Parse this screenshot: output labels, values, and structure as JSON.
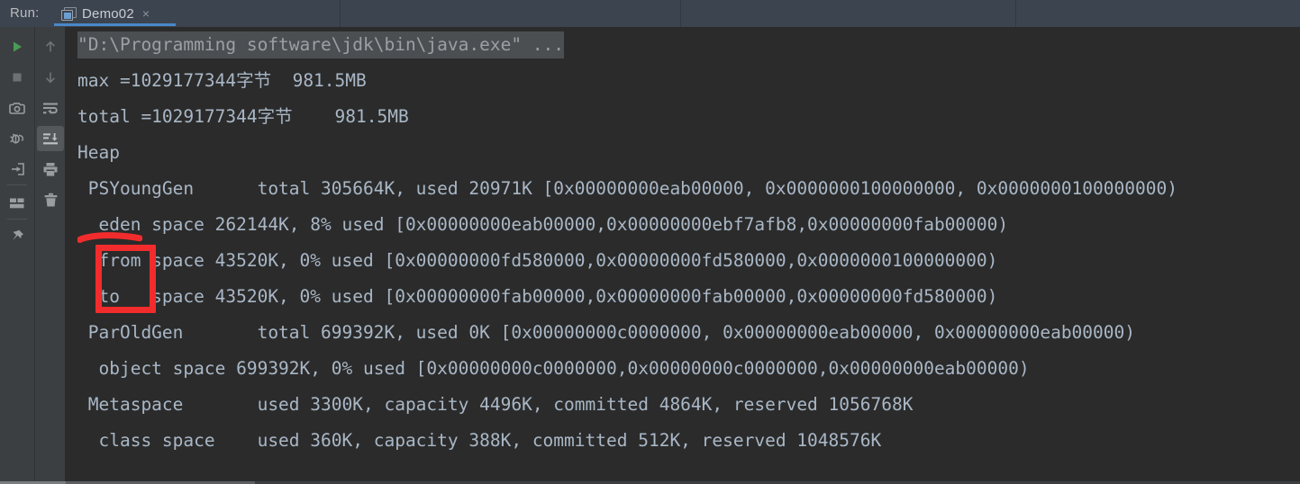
{
  "window": {
    "tool_window_title": "Run:",
    "background_color": "#2b2b2b",
    "tabbar_color": "#3c4450",
    "accent_color": "#4a88c7",
    "annotation_color": "#f22c2c"
  },
  "tabs": [
    {
      "label": "Demo02",
      "icon": "run-configuration-icon",
      "close_label": "×",
      "active": true
    }
  ],
  "toolbar_left": [
    {
      "name": "rerun-button",
      "icon": "play-triangle-icon",
      "enabled": true,
      "selected": false
    },
    {
      "name": "stop-button",
      "icon": "stop-square-icon",
      "enabled": false,
      "selected": false
    },
    {
      "name": "screenshot-button",
      "icon": "camera-icon",
      "enabled": true,
      "selected": false
    },
    {
      "name": "rerun-failed-button",
      "icon": "bug-rerun-icon",
      "enabled": true,
      "selected": false
    },
    {
      "name": "import-button",
      "icon": "arrow-into-box-icon",
      "enabled": true,
      "selected": false
    },
    {
      "name": "layout-button",
      "icon": "layout-panels-icon",
      "enabled": true,
      "selected": false
    },
    {
      "name": "pin-tab-button",
      "icon": "pin-icon",
      "enabled": true,
      "selected": false
    }
  ],
  "toolbar_right": [
    {
      "name": "up-the-stack-trace-button",
      "icon": "arrow-up-icon",
      "enabled": false,
      "selected": false
    },
    {
      "name": "down-the-stack-trace-button",
      "icon": "arrow-down-icon",
      "enabled": false,
      "selected": false
    },
    {
      "name": "soft-wrap-button",
      "icon": "soft-wrap-icon",
      "enabled": true,
      "selected": false
    },
    {
      "name": "scroll-to-end-button",
      "icon": "scroll-to-end-icon",
      "enabled": true,
      "selected": true
    },
    {
      "name": "print-button",
      "icon": "printer-icon",
      "enabled": true,
      "selected": false
    },
    {
      "name": "clear-all-button",
      "icon": "trash-can-icon",
      "enabled": true,
      "selected": false
    }
  ],
  "console": {
    "lines": [
      {
        "id": "cmdline",
        "text": "\"D:\\Programming software\\jdk\\bin\\java.exe\" ...",
        "highlighted": true
      },
      {
        "id": "max",
        "text": "max =1029177344字节  981.5MB",
        "highlighted": false
      },
      {
        "id": "total",
        "text": "total =1029177344字节    981.5MB",
        "highlighted": false
      },
      {
        "id": "heap",
        "text": "Heap",
        "highlighted": false
      },
      {
        "id": "psyounggen",
        "text": " PSYoungGen      total 305664K, used 20971K [0x00000000eab00000, 0x0000000100000000, 0x0000000100000000)",
        "highlighted": false
      },
      {
        "id": "eden",
        "text": "  eden space 262144K, 8% used [0x00000000eab00000,0x00000000ebf7afb8,0x00000000fab00000)",
        "highlighted": false
      },
      {
        "id": "from",
        "text": "  from space 43520K, 0% used [0x00000000fd580000,0x00000000fd580000,0x0000000100000000)",
        "highlighted": false
      },
      {
        "id": "to",
        "text": "  to   space 43520K, 0% used [0x00000000fab00000,0x00000000fab00000,0x00000000fd580000)",
        "highlighted": false
      },
      {
        "id": "paroldgen",
        "text": " ParOldGen       total 699392K, used 0K [0x00000000c0000000, 0x00000000eab00000, 0x00000000eab00000)",
        "highlighted": false
      },
      {
        "id": "objectspace",
        "text": "  object space 699392K, 0% used [0x00000000c0000000,0x00000000c0000000,0x00000000eab00000)",
        "highlighted": false
      },
      {
        "id": "metaspace",
        "text": " Metaspace       used 3300K, capacity 4496K, committed 4864K, reserved 1056768K",
        "highlighted": false
      },
      {
        "id": "classspace",
        "text": "  class space    used 360K, capacity 388K, committed 512K, reserved 1048576K",
        "highlighted": false
      }
    ]
  },
  "annotations": [
    {
      "name": "red-highlight-rectangle",
      "shape": "rectangle",
      "targets": [
        "from",
        "to"
      ],
      "color": "#f22c2c"
    },
    {
      "name": "red-brush-stroke",
      "shape": "stroke",
      "color": "#f22c2c"
    }
  ]
}
